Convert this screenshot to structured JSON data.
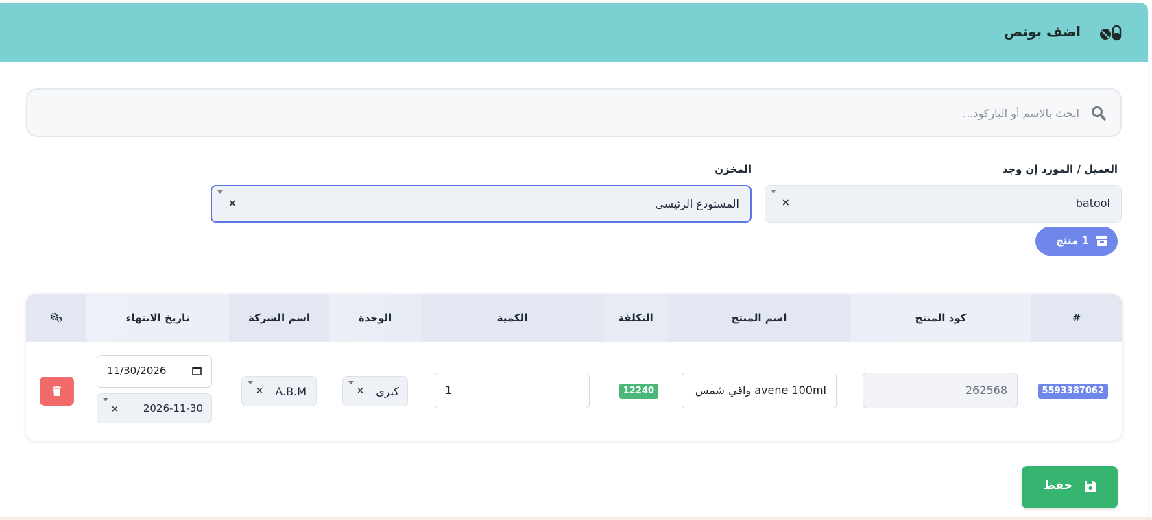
{
  "header": {
    "title": "اضف بونص",
    "icon": "pills-icon"
  },
  "search": {
    "placeholder": "ابحث بالاسم أو الباركود..."
  },
  "customer": {
    "label": "العميل / المورد إن وجد",
    "value": "batool"
  },
  "warehouse": {
    "label": "المخزن",
    "value": "المستودع الرئيسي"
  },
  "product_count": {
    "label": "1 منتج"
  },
  "table": {
    "headers": {
      "index": "#",
      "code": "كود المنتج",
      "name": "اسم المنتج",
      "cost": "التكلفة",
      "quantity": "الكمية",
      "unit": "الوحدة",
      "company": "اسم الشركة",
      "expiry": "تاريخ الانتهاء"
    },
    "rows": [
      {
        "barcode": "5593387062",
        "code": "262568",
        "name": "avene 100ml واقي شمس",
        "cost": "12240",
        "quantity": "1",
        "unit": "كبرى",
        "company": "A.B.M",
        "expiry_date": "11/30/2026",
        "expiry_select": "2026-11-30"
      }
    ]
  },
  "actions": {
    "save_label": "حفظ"
  },
  "colors": {
    "header_bg": "#7bd1d1",
    "accent": "#6f86ea",
    "save": "#35b56f",
    "delete": "#f26b6b",
    "cost_badge": "#49b878",
    "barcode_badge": "#6f86ea"
  },
  "clear_mark": "×"
}
